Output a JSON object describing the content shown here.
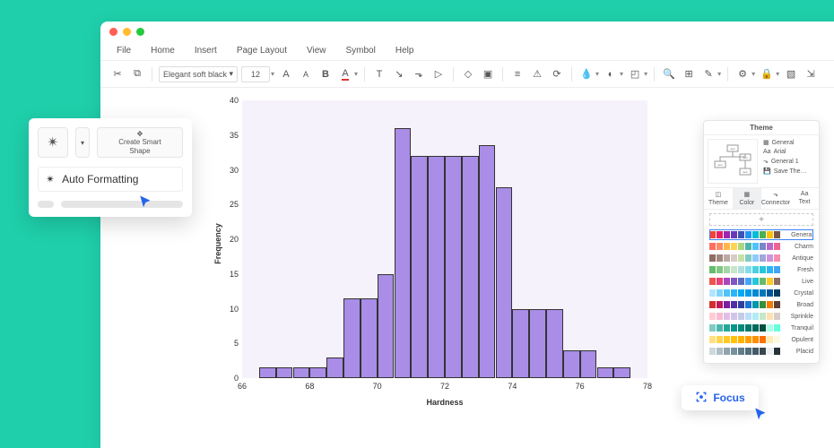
{
  "menubar": {
    "file": "File",
    "home": "Home",
    "insert": "Insert",
    "page_layout": "Page Layout",
    "view": "View",
    "symbol": "Symbol",
    "help": "Help"
  },
  "toolbar": {
    "font_name": "Elegant soft black",
    "font_size": "12"
  },
  "autoformat": {
    "create_smart_shape_l1": "Create Smart",
    "create_smart_shape_l2": "Shape",
    "title": "Auto Formatting"
  },
  "theme": {
    "header": "Theme",
    "opts": {
      "general": "General",
      "arial": "Arial",
      "general1": "General 1",
      "save": "Save The…"
    },
    "tabs": {
      "theme": "Theme",
      "color": "Color",
      "connector": "Connector",
      "text": "Text"
    },
    "palettes": [
      "General",
      "Charm",
      "Antique",
      "Fresh",
      "Live",
      "Crystal",
      "Broad",
      "Sprinkle",
      "Tranquil",
      "Opulent",
      "Placid"
    ]
  },
  "focus": {
    "label": "Focus"
  },
  "chart_data": {
    "type": "bar",
    "title": "",
    "xlabel": "Hardness",
    "ylabel": "Frequency",
    "xlim": [
      66,
      78
    ],
    "ylim": [
      0,
      40
    ],
    "x_ticks": [
      66,
      68,
      70,
      72,
      74,
      76,
      78
    ],
    "y_ticks": [
      0,
      5,
      10,
      15,
      20,
      25,
      30,
      35,
      40
    ],
    "bins": [
      {
        "x0": 66.5,
        "x1": 67.0,
        "y": 1.5
      },
      {
        "x0": 67.0,
        "x1": 67.5,
        "y": 1.5
      },
      {
        "x0": 67.5,
        "x1": 68.0,
        "y": 1.5
      },
      {
        "x0": 68.0,
        "x1": 68.5,
        "y": 1.5
      },
      {
        "x0": 68.5,
        "x1": 69.0,
        "y": 3
      },
      {
        "x0": 69.0,
        "x1": 69.5,
        "y": 11.5
      },
      {
        "x0": 69.5,
        "x1": 70.0,
        "y": 11.5
      },
      {
        "x0": 70.0,
        "x1": 70.5,
        "y": 15
      },
      {
        "x0": 70.5,
        "x1": 71.0,
        "y": 36
      },
      {
        "x0": 71.0,
        "x1": 71.5,
        "y": 32
      },
      {
        "x0": 71.5,
        "x1": 72.0,
        "y": 32
      },
      {
        "x0": 72.0,
        "x1": 72.5,
        "y": 32
      },
      {
        "x0": 72.5,
        "x1": 73.0,
        "y": 32
      },
      {
        "x0": 73.0,
        "x1": 73.5,
        "y": 33.5
      },
      {
        "x0": 73.5,
        "x1": 74.0,
        "y": 27.5
      },
      {
        "x0": 74.0,
        "x1": 74.5,
        "y": 10
      },
      {
        "x0": 74.5,
        "x1": 75.0,
        "y": 10
      },
      {
        "x0": 75.0,
        "x1": 75.5,
        "y": 10
      },
      {
        "x0": 75.5,
        "x1": 76.0,
        "y": 4
      },
      {
        "x0": 76.0,
        "x1": 76.5,
        "y": 4
      },
      {
        "x0": 76.5,
        "x1": 77.0,
        "y": 1.5
      },
      {
        "x0": 77.0,
        "x1": 77.5,
        "y": 1.5
      }
    ]
  },
  "palette_colors": [
    [
      "#f44336",
      "#e91e63",
      "#9c27b0",
      "#673ab7",
      "#3f51b5",
      "#2196f3",
      "#00bcd4",
      "#4caf50",
      "#ffc107",
      "#795548"
    ],
    [
      "#ff6f61",
      "#ff8a65",
      "#ffb74d",
      "#ffd54f",
      "#aed581",
      "#4db6ac",
      "#4fc3f7",
      "#7986cb",
      "#ba68c8",
      "#f06292"
    ],
    [
      "#8d6e63",
      "#a1887f",
      "#bcaaa4",
      "#d7ccc8",
      "#c5e1a5",
      "#80cbc4",
      "#90caf9",
      "#9fa8da",
      "#ce93d8",
      "#f48fb1"
    ],
    [
      "#66bb6a",
      "#81c784",
      "#a5d6a7",
      "#c8e6c9",
      "#b2dfdb",
      "#80deea",
      "#4dd0e1",
      "#26c6da",
      "#29b6f6",
      "#42a5f5"
    ],
    [
      "#ef5350",
      "#ec407a",
      "#ab47bc",
      "#7e57c2",
      "#5c6bc0",
      "#42a5f5",
      "#26c6da",
      "#66bb6a",
      "#ffca28",
      "#8d6e63"
    ],
    [
      "#b3e5fc",
      "#81d4fa",
      "#4fc3f7",
      "#29b6f6",
      "#03a9f4",
      "#039be5",
      "#0288d1",
      "#0277bd",
      "#01579b",
      "#013a63"
    ],
    [
      "#d32f2f",
      "#c2185b",
      "#7b1fa2",
      "#512da8",
      "#303f9f",
      "#1976d2",
      "#0097a7",
      "#388e3c",
      "#f57c00",
      "#5d4037"
    ],
    [
      "#ffcdd2",
      "#f8bbd0",
      "#e1bee7",
      "#d1c4e9",
      "#c5cae9",
      "#bbdefb",
      "#b2ebf2",
      "#c8e6c9",
      "#ffe0b2",
      "#d7ccc8"
    ],
    [
      "#80cbc4",
      "#4db6ac",
      "#26a69a",
      "#009688",
      "#00897b",
      "#00796b",
      "#00695c",
      "#004d40",
      "#a7ffeb",
      "#64ffda"
    ],
    [
      "#ffe082",
      "#ffd54f",
      "#ffca28",
      "#ffc107",
      "#ffb300",
      "#ffa000",
      "#ff8f00",
      "#ff6f00",
      "#ffecb3",
      "#fff8e1"
    ],
    [
      "#cfd8dc",
      "#b0bec5",
      "#90a4ae",
      "#78909c",
      "#607d8b",
      "#546e7a",
      "#455a64",
      "#37474f",
      "#eceff1",
      "#263238"
    ]
  ]
}
